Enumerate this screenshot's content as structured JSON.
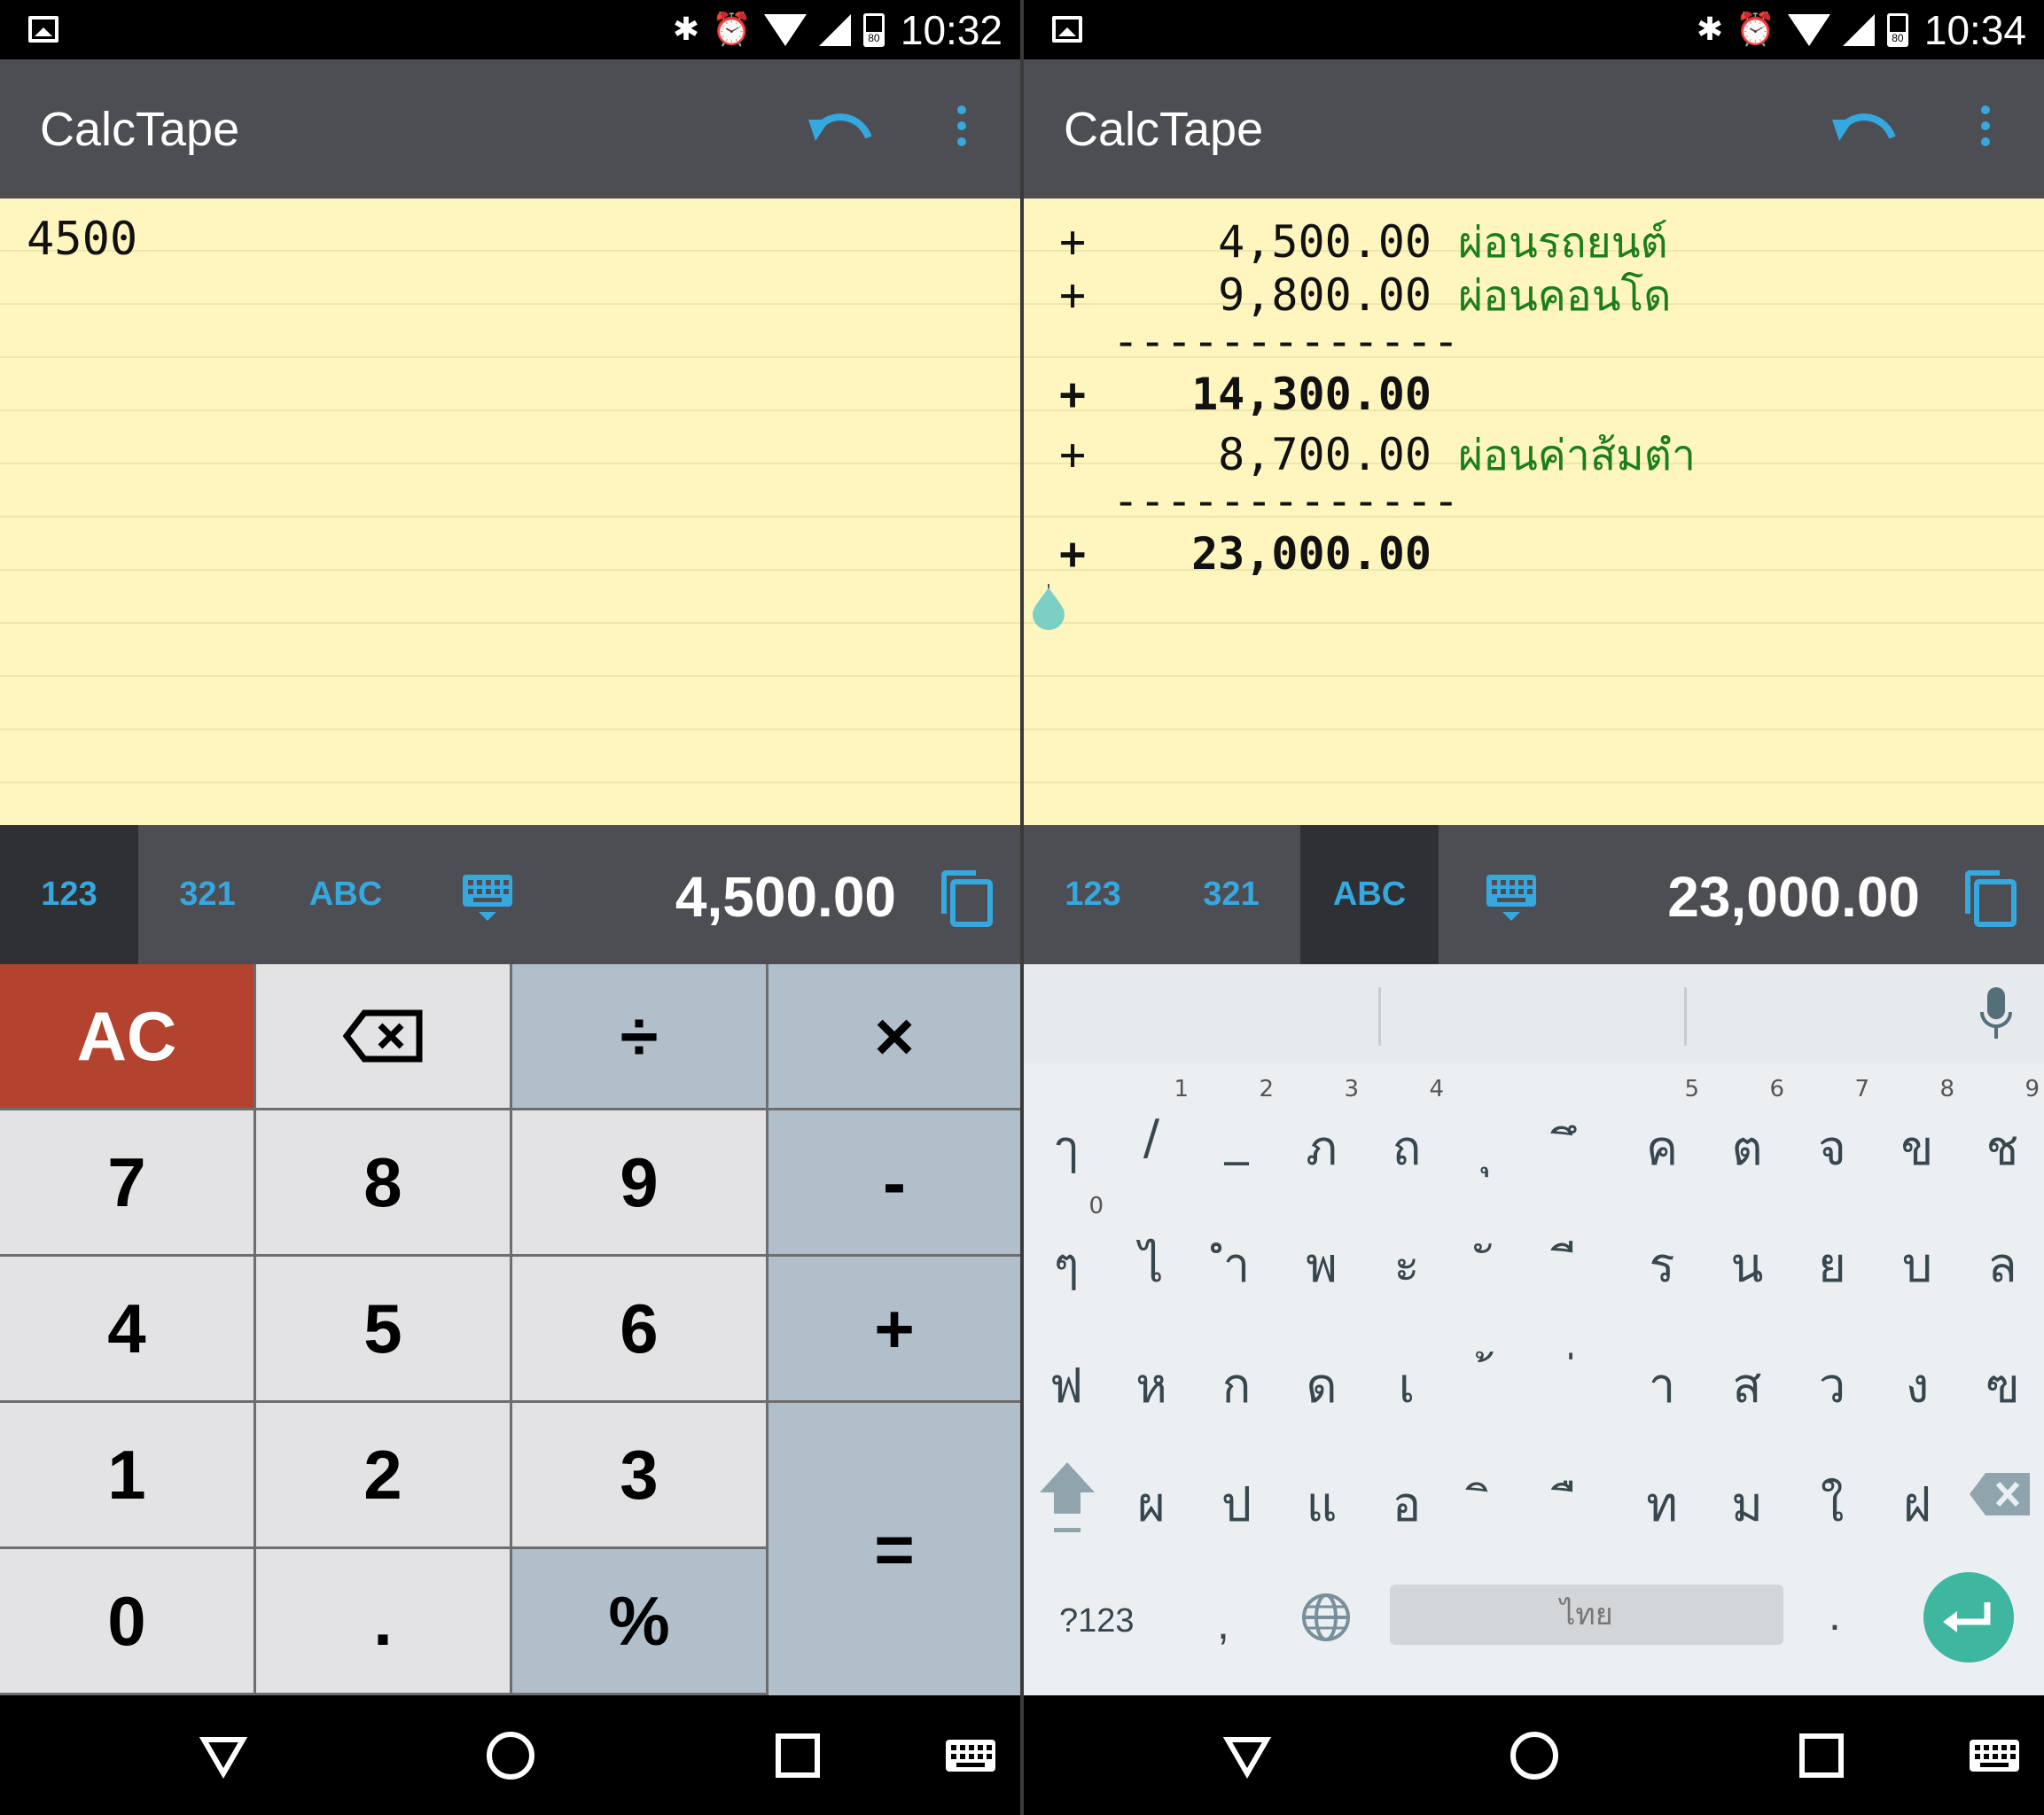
{
  "left": {
    "status": {
      "time": "10:32",
      "battery": "80"
    },
    "app": {
      "title": "CalcTape"
    },
    "input_text": "4500",
    "modes": [
      {
        "label": "123",
        "active": true
      },
      {
        "label": "321",
        "active": false
      },
      {
        "label": "ABC",
        "active": false
      }
    ],
    "result": "4,500.00",
    "keypad": [
      {
        "label": "AC",
        "type": "ac",
        "name": "all-clear-key"
      },
      {
        "label": "⌫",
        "type": "num",
        "name": "backspace-key"
      },
      {
        "label": "÷",
        "type": "op",
        "name": "divide-key"
      },
      {
        "label": "×",
        "type": "op",
        "name": "multiply-key"
      },
      {
        "label": "7",
        "type": "num",
        "name": "key-7"
      },
      {
        "label": "8",
        "type": "num",
        "name": "key-8"
      },
      {
        "label": "9",
        "type": "num",
        "name": "key-9"
      },
      {
        "label": "-",
        "type": "op",
        "name": "minus-key"
      },
      {
        "label": "4",
        "type": "num",
        "name": "key-4"
      },
      {
        "label": "5",
        "type": "num",
        "name": "key-5"
      },
      {
        "label": "6",
        "type": "num",
        "name": "key-6"
      },
      {
        "label": "+",
        "type": "op",
        "name": "plus-key"
      },
      {
        "label": "1",
        "type": "num",
        "name": "key-1"
      },
      {
        "label": "2",
        "type": "num",
        "name": "key-2"
      },
      {
        "label": "3",
        "type": "num",
        "name": "key-3"
      },
      {
        "label": "=",
        "type": "op",
        "name": "equals-key"
      },
      {
        "label": "0",
        "type": "num",
        "name": "key-0"
      },
      {
        "label": ".",
        "type": "num",
        "name": "decimal-key"
      },
      {
        "label": "%",
        "type": "op",
        "name": "percent-key"
      }
    ]
  },
  "right": {
    "status": {
      "time": "10:34",
      "battery": "80"
    },
    "app": {
      "title": "CalcTape"
    },
    "tape": [
      {
        "op": "+",
        "amount": "4,500.00",
        "note": "ผ่อนรถยนต์",
        "bold": false
      },
      {
        "op": "+",
        "amount": "9,800.00",
        "note": "ผ่อนคอนโด",
        "bold": false
      },
      {
        "op": "",
        "amount": "-------------",
        "note": "",
        "bold": false
      },
      {
        "op": "+",
        "amount": "14,300.00",
        "note": "",
        "bold": true
      },
      {
        "op": "+",
        "amount": "8,700.00",
        "note": "ผ่อนค่าส้มตำ",
        "bold": false
      },
      {
        "op": "",
        "amount": "-------------",
        "note": "",
        "bold": false
      },
      {
        "op": "+",
        "amount": "23,000.00",
        "note": "",
        "bold": true
      }
    ],
    "modes": [
      {
        "label": "123",
        "active": false
      },
      {
        "label": "321",
        "active": false
      },
      {
        "label": "ABC",
        "active": true
      }
    ],
    "result": "23,000.00",
    "keyboard": {
      "rows": [
        [
          {
            "c": "ๅ",
            "h": ""
          },
          {
            "c": "/",
            "h": "1"
          },
          {
            "c": "_",
            "h": "2"
          },
          {
            "c": "ภ",
            "h": "3"
          },
          {
            "c": "ถ",
            "h": "4"
          },
          {
            "c": "ุ",
            "h": ""
          },
          {
            "c": "ึ",
            "h": ""
          },
          {
            "c": "ค",
            "h": "5"
          },
          {
            "c": "ต",
            "h": "6"
          },
          {
            "c": "จ",
            "h": "7"
          },
          {
            "c": "ข",
            "h": "8"
          },
          {
            "c": "ช",
            "h": "9"
          }
        ],
        [
          {
            "c": "ๆ",
            "h": "0"
          },
          {
            "c": "ไ",
            "h": ""
          },
          {
            "c": "ำ",
            "h": ""
          },
          {
            "c": "พ",
            "h": ""
          },
          {
            "c": "ะ",
            "h": ""
          },
          {
            "c": "ั",
            "h": ""
          },
          {
            "c": "ี",
            "h": ""
          },
          {
            "c": "ร",
            "h": ""
          },
          {
            "c": "น",
            "h": ""
          },
          {
            "c": "ย",
            "h": ""
          },
          {
            "c": "บ",
            "h": ""
          },
          {
            "c": "ล",
            "h": ""
          }
        ],
        [
          {
            "c": "ฟ",
            "h": ""
          },
          {
            "c": "ห",
            "h": ""
          },
          {
            "c": "ก",
            "h": ""
          },
          {
            "c": "ด",
            "h": ""
          },
          {
            "c": "เ",
            "h": ""
          },
          {
            "c": "้",
            "h": ""
          },
          {
            "c": "่",
            "h": ""
          },
          {
            "c": "า",
            "h": ""
          },
          {
            "c": "ส",
            "h": ""
          },
          {
            "c": "ว",
            "h": ""
          },
          {
            "c": "ง",
            "h": ""
          },
          {
            "c": "ฃ",
            "h": ""
          }
        ],
        [
          {
            "c": "ผ",
            "h": ""
          },
          {
            "c": "ป",
            "h": ""
          },
          {
            "c": "แ",
            "h": ""
          },
          {
            "c": "อ",
            "h": ""
          },
          {
            "c": "ิ",
            "h": ""
          },
          {
            "c": "ื",
            "h": ""
          },
          {
            "c": "ท",
            "h": ""
          },
          {
            "c": "ม",
            "h": ""
          },
          {
            "c": "ใ",
            "h": ""
          },
          {
            "c": "ฝ",
            "h": ""
          }
        ]
      ],
      "symbols_label": "?123",
      "comma": ",",
      "space_label": "ไทย",
      "period": "."
    }
  },
  "colors": {
    "accent": "#35a8e0",
    "appbar": "#4d4e53",
    "tape_bg": "#fff6bf",
    "note": "#1a7f1a",
    "ac": "#b3432e",
    "op": "#b1bfcb",
    "num": "#e3e3e5",
    "enter": "#3fb6a0"
  },
  "icons": [
    "gallery-icon",
    "bluetooth-icon",
    "alarm-icon",
    "wifi-icon",
    "signal-icon",
    "battery-icon",
    "undo-icon",
    "more-icon",
    "keyboard-toggle-icon",
    "copy-icon",
    "mic-icon",
    "shift-icon",
    "backspace-icon",
    "globe-icon",
    "enter-icon",
    "back-icon",
    "home-icon",
    "recents-icon",
    "keyboard-icon"
  ]
}
